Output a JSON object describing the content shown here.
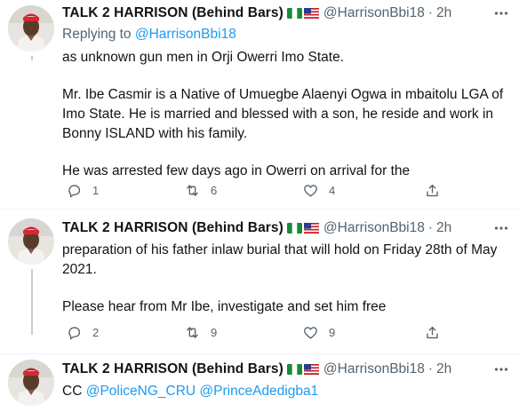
{
  "colors": {
    "text": "#0f1419",
    "secondary": "#536471",
    "link": "#1d9bf0",
    "divider": "#eff3f4",
    "thread_line": "#c4cfd6"
  },
  "icons": [
    "nigeria-flag-icon",
    "us-flag-icon",
    "more-options-icon",
    "reply-icon",
    "retweet-icon",
    "like-icon",
    "share-icon"
  ],
  "tweets": [
    {
      "author_name": "TALK 2 HARRISON (Behind Bars)",
      "handle": "@HarrisonBbi18",
      "separator": "·",
      "time": "2h",
      "replying_prefix": "Replying to",
      "replying_handle": "@HarrisonBbi18",
      "paragraphs": [
        "as unknown gun men in Orji Owerri Imo State.",
        "Mr. Ibe Casmir is a Native of Umuegbe Alaenyi Ogwa in mbaitolu LGA of Imo State. He is married and blessed with a son, he reside and work in Bonny ISLAND with his family.",
        "He was arrested few days ago in Owerri on arrival for the"
      ],
      "replies": "1",
      "retweets": "6",
      "likes": "4"
    },
    {
      "author_name": "TALK 2 HARRISON (Behind Bars)",
      "handle": "@HarrisonBbi18",
      "separator": "·",
      "time": "2h",
      "paragraphs": [
        "preparation of his father inlaw burial that will hold on Friday 28th of May 2021.",
        "Please hear from Mr Ibe, investigate and set him free"
      ],
      "replies": "2",
      "retweets": "9",
      "likes": "9"
    },
    {
      "author_name": "TALK 2 HARRISON (Behind Bars)",
      "handle": "@HarrisonBbi18",
      "separator": "·",
      "time": "2h",
      "body_prefix": "CC",
      "mention_1": "@PoliceNG_CRU",
      "mention_2": "@PrinceAdedigba1"
    }
  ]
}
